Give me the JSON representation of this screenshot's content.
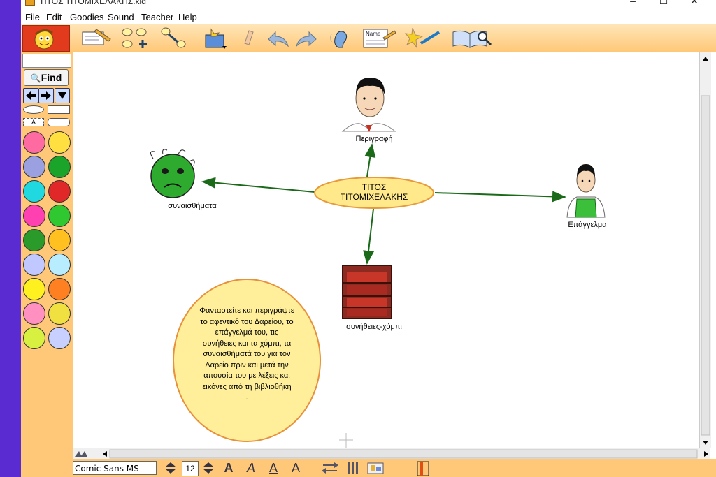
{
  "window": {
    "title": "ΤΙΤΟΣ ΤΙΤΟΜΙΧΕΛΑΚΗΣ.kid",
    "minimize": "–",
    "maximize": "☐",
    "close": "✕"
  },
  "menu": [
    "File",
    "Edit",
    "Goodies",
    "Sound",
    "Teacher",
    "Help"
  ],
  "toolbar": {
    "icons": [
      "kidspiration-logo-icon",
      "picture-note-icon",
      "create-nodes-icon",
      "link-arrow-icon",
      "symbol-box-icon",
      "eraser-icon",
      "undo-icon",
      "redo-icon",
      "listen-ear-icon",
      "name-card-icon",
      "magic-wand-icon",
      "open-book-search-icon"
    ],
    "name_label": "Name"
  },
  "sidebar": {
    "find_label": "Find",
    "text_label": "A"
  },
  "canvas": {
    "center_node": {
      "line1": "ΤΙΤΟΣ",
      "line2": "ΤΙΤΟΜΙΧΕΛΑΚΗΣ"
    },
    "nodes": {
      "description": "Περιγραφή",
      "feelings": "συναισθήματα",
      "profession": "Επάγγελμα",
      "habits": "συνήθειες-χόμπι"
    },
    "note_lines": [
      "Φανταστείτε και περιγράψτε",
      "το αφεντικό του Δαρείου, το",
      "επάγγελμά του, τις",
      "συνήθειες και τα χόμπι, τα",
      "συναισθήματά του για τον",
      "Δαρείο πριν και μετά την",
      "απουσία του με λέξεις και",
      "εικόνες από τη βιβλιοθήκη",
      "."
    ]
  },
  "statusbar": {
    "font": "Comic Sans MS",
    "size": "12",
    "bold_a": "A",
    "italic_a": "A",
    "underline_a": "A",
    "color_a": "A"
  },
  "colors": {
    "background": "#5a2bd0",
    "panel": "#ffc878",
    "link": "#1a6a1a",
    "center_fill": "#ffe98a",
    "center_border": "#e89a3a"
  }
}
